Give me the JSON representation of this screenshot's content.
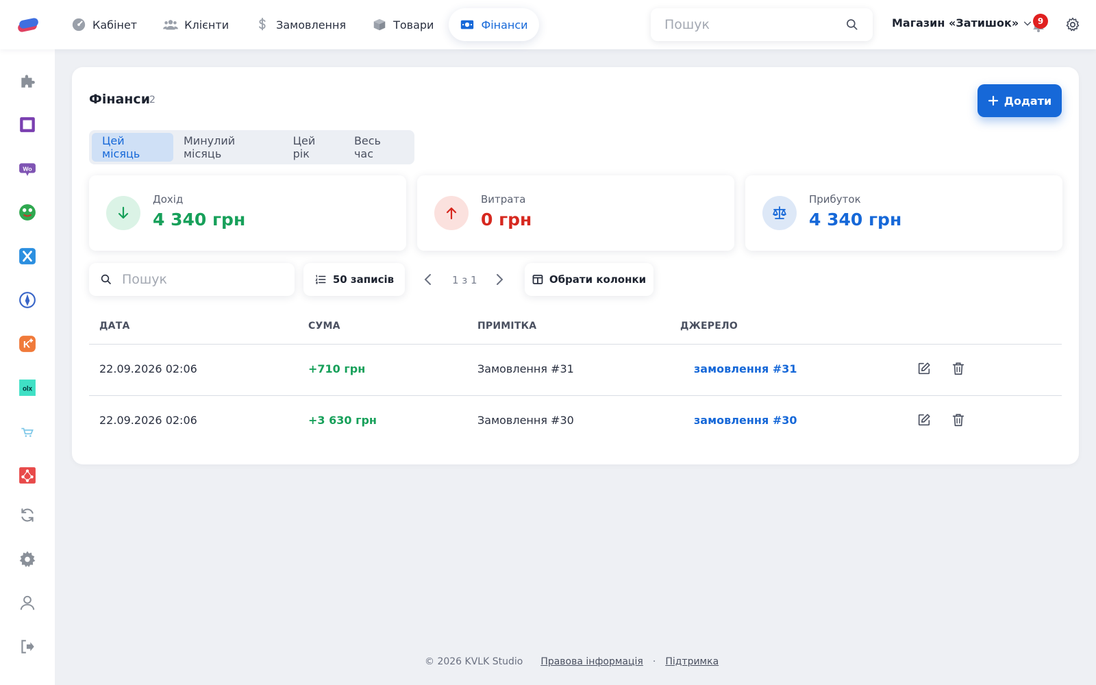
{
  "nav": {
    "items": [
      {
        "label": "Кабінет",
        "icon": "dashboard-icon"
      },
      {
        "label": "Клієнти",
        "icon": "users-icon"
      },
      {
        "label": "Замовлення",
        "icon": "dollar-icon"
      },
      {
        "label": "Товари",
        "icon": "box-icon"
      },
      {
        "label": "Фінанси",
        "icon": "money-icon",
        "active": true
      }
    ],
    "search_placeholder": "Пошук",
    "store_name": "Магазин «Затишок»",
    "notifications_count": "9"
  },
  "sidebar": {
    "items": [
      {
        "icon": "puzzle-icon"
      },
      {
        "icon": "square-app-icon"
      },
      {
        "icon": "woo-icon"
      },
      {
        "icon": "frog-app-icon"
      },
      {
        "icon": "x-app-icon"
      },
      {
        "icon": "compass-app-icon"
      },
      {
        "icon": "k-plus-app-icon"
      },
      {
        "icon": "olx-icon"
      },
      {
        "icon": "cart-app-icon"
      },
      {
        "icon": "nodes-app-icon"
      },
      {
        "icon": "sync-icon"
      },
      {
        "icon": "gear-icon"
      },
      {
        "icon": "user-icon"
      },
      {
        "icon": "logout-icon"
      }
    ]
  },
  "page": {
    "title": "Фінанси",
    "count": "2",
    "add_label": "Додати",
    "tabs": [
      "Цей місяць",
      "Минулий місяць",
      "Цей рік",
      "Весь час"
    ],
    "active_tab": "Цей місяць"
  },
  "stats": [
    {
      "label": "Дохід",
      "value": "4 340 грн",
      "color": "#17a05a",
      "icon": "arrow-down-icon"
    },
    {
      "label": "Витрата",
      "value": "0 грн",
      "color": "#d6281f",
      "icon": "arrow-up-icon"
    },
    {
      "label": "Прибуток",
      "value": "4 340 грн",
      "color": "#1668d8",
      "icon": "scales-icon"
    }
  ],
  "table": {
    "search_placeholder": "Пошук",
    "records_label": "50 записів",
    "pager": "1 з 1",
    "columns_label": "Обрати колонки",
    "headers": [
      "ДАТА",
      "СУМА",
      "ПРИМІТКА",
      "ДЖЕРЕЛО"
    ],
    "rows": [
      {
        "date": "22.09.2026 02:06",
        "sum": "+710 грн",
        "note": "Замовлення #31",
        "source": "замовлення #31"
      },
      {
        "date": "22.09.2026 02:06",
        "sum": "+3 630 грн",
        "note": "Замовлення #30",
        "source": "замовлення #30"
      }
    ]
  },
  "footer": {
    "copyright": "© 2026 KVLK Studio",
    "legal": "Правова інформація",
    "separator": "·",
    "support": "Підтримка"
  },
  "colors": {
    "accent": "#1668d8",
    "income": "#17a05a",
    "expense": "#d6281f"
  }
}
